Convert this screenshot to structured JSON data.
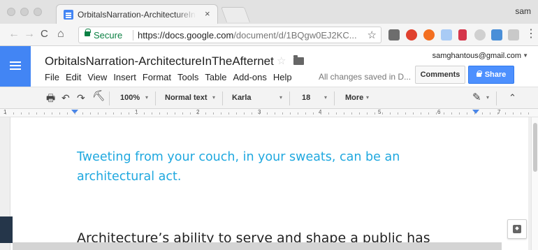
{
  "browser": {
    "tab_title": "OrbitalsNarration-ArchitectureInTheAfternet",
    "tab_close": "×",
    "user": "sam",
    "nav": {
      "back": "←",
      "forward": "→",
      "reload": "C",
      "home": "⌂"
    },
    "secure_label": "Secure",
    "url_host": "https://docs.google.com",
    "url_path": "/document/d/1BQgw0EJ2KC...",
    "bookmark_star": "☆",
    "menu_dots": "⋮"
  },
  "docs": {
    "title": "OrbitalsNarration-ArchitectureInTheAfternet",
    "title_star": "☆",
    "account": "samghantous@gmail.com",
    "account_caret": "▼",
    "menu": [
      "File",
      "Edit",
      "View",
      "Insert",
      "Format",
      "Tools",
      "Table",
      "Add-ons",
      "Help"
    ],
    "saved_status": "All changes saved in D...",
    "comments_label": "Comments",
    "share_label": "Share"
  },
  "toolbar": {
    "zoom": "100%",
    "style": "Normal text",
    "font": "Karla",
    "size": "18",
    "more": "More",
    "caret": "▾",
    "collapse": "⌃"
  },
  "ruler": {
    "numbers": [
      "1",
      "1",
      "2",
      "3",
      "4",
      "5",
      "6",
      "7"
    ]
  },
  "document": {
    "quote_line1": "Tweeting from your couch, in your sweats, can be an",
    "quote_line2": "architectural act.",
    "body_line": "Architecture’s ability to serve and shape a public has"
  },
  "colors": {
    "docs_blue": "#4285f4",
    "share_blue": "#4d90fe",
    "quote_cyan": "#1fa8df",
    "secure_green": "#0b8043"
  }
}
